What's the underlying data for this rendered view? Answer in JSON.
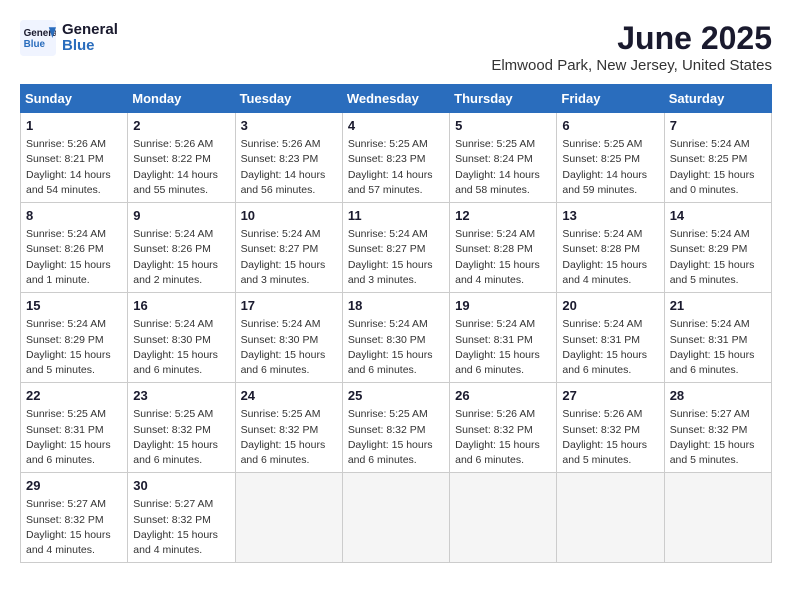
{
  "header": {
    "logo_line1": "General",
    "logo_line2": "Blue",
    "month_title": "June 2025",
    "location": "Elmwood Park, New Jersey, United States"
  },
  "weekdays": [
    "Sunday",
    "Monday",
    "Tuesday",
    "Wednesday",
    "Thursday",
    "Friday",
    "Saturday"
  ],
  "weeks": [
    [
      {
        "day": "1",
        "sunrise": "5:26 AM",
        "sunset": "8:21 PM",
        "daylight": "14 hours and 54 minutes."
      },
      {
        "day": "2",
        "sunrise": "5:26 AM",
        "sunset": "8:22 PM",
        "daylight": "14 hours and 55 minutes."
      },
      {
        "day": "3",
        "sunrise": "5:26 AM",
        "sunset": "8:23 PM",
        "daylight": "14 hours and 56 minutes."
      },
      {
        "day": "4",
        "sunrise": "5:25 AM",
        "sunset": "8:23 PM",
        "daylight": "14 hours and 57 minutes."
      },
      {
        "day": "5",
        "sunrise": "5:25 AM",
        "sunset": "8:24 PM",
        "daylight": "14 hours and 58 minutes."
      },
      {
        "day": "6",
        "sunrise": "5:25 AM",
        "sunset": "8:25 PM",
        "daylight": "14 hours and 59 minutes."
      },
      {
        "day": "7",
        "sunrise": "5:24 AM",
        "sunset": "8:25 PM",
        "daylight": "15 hours and 0 minutes."
      }
    ],
    [
      {
        "day": "8",
        "sunrise": "5:24 AM",
        "sunset": "8:26 PM",
        "daylight": "15 hours and 1 minute."
      },
      {
        "day": "9",
        "sunrise": "5:24 AM",
        "sunset": "8:26 PM",
        "daylight": "15 hours and 2 minutes."
      },
      {
        "day": "10",
        "sunrise": "5:24 AM",
        "sunset": "8:27 PM",
        "daylight": "15 hours and 3 minutes."
      },
      {
        "day": "11",
        "sunrise": "5:24 AM",
        "sunset": "8:27 PM",
        "daylight": "15 hours and 3 minutes."
      },
      {
        "day": "12",
        "sunrise": "5:24 AM",
        "sunset": "8:28 PM",
        "daylight": "15 hours and 4 minutes."
      },
      {
        "day": "13",
        "sunrise": "5:24 AM",
        "sunset": "8:28 PM",
        "daylight": "15 hours and 4 minutes."
      },
      {
        "day": "14",
        "sunrise": "5:24 AM",
        "sunset": "8:29 PM",
        "daylight": "15 hours and 5 minutes."
      }
    ],
    [
      {
        "day": "15",
        "sunrise": "5:24 AM",
        "sunset": "8:29 PM",
        "daylight": "15 hours and 5 minutes."
      },
      {
        "day": "16",
        "sunrise": "5:24 AM",
        "sunset": "8:30 PM",
        "daylight": "15 hours and 6 minutes."
      },
      {
        "day": "17",
        "sunrise": "5:24 AM",
        "sunset": "8:30 PM",
        "daylight": "15 hours and 6 minutes."
      },
      {
        "day": "18",
        "sunrise": "5:24 AM",
        "sunset": "8:30 PM",
        "daylight": "15 hours and 6 minutes."
      },
      {
        "day": "19",
        "sunrise": "5:24 AM",
        "sunset": "8:31 PM",
        "daylight": "15 hours and 6 minutes."
      },
      {
        "day": "20",
        "sunrise": "5:24 AM",
        "sunset": "8:31 PM",
        "daylight": "15 hours and 6 minutes."
      },
      {
        "day": "21",
        "sunrise": "5:24 AM",
        "sunset": "8:31 PM",
        "daylight": "15 hours and 6 minutes."
      }
    ],
    [
      {
        "day": "22",
        "sunrise": "5:25 AM",
        "sunset": "8:31 PM",
        "daylight": "15 hours and 6 minutes."
      },
      {
        "day": "23",
        "sunrise": "5:25 AM",
        "sunset": "8:32 PM",
        "daylight": "15 hours and 6 minutes."
      },
      {
        "day": "24",
        "sunrise": "5:25 AM",
        "sunset": "8:32 PM",
        "daylight": "15 hours and 6 minutes."
      },
      {
        "day": "25",
        "sunrise": "5:25 AM",
        "sunset": "8:32 PM",
        "daylight": "15 hours and 6 minutes."
      },
      {
        "day": "26",
        "sunrise": "5:26 AM",
        "sunset": "8:32 PM",
        "daylight": "15 hours and 6 minutes."
      },
      {
        "day": "27",
        "sunrise": "5:26 AM",
        "sunset": "8:32 PM",
        "daylight": "15 hours and 5 minutes."
      },
      {
        "day": "28",
        "sunrise": "5:27 AM",
        "sunset": "8:32 PM",
        "daylight": "15 hours and 5 minutes."
      }
    ],
    [
      {
        "day": "29",
        "sunrise": "5:27 AM",
        "sunset": "8:32 PM",
        "daylight": "15 hours and 4 minutes."
      },
      {
        "day": "30",
        "sunrise": "5:27 AM",
        "sunset": "8:32 PM",
        "daylight": "15 hours and 4 minutes."
      },
      null,
      null,
      null,
      null,
      null
    ]
  ]
}
